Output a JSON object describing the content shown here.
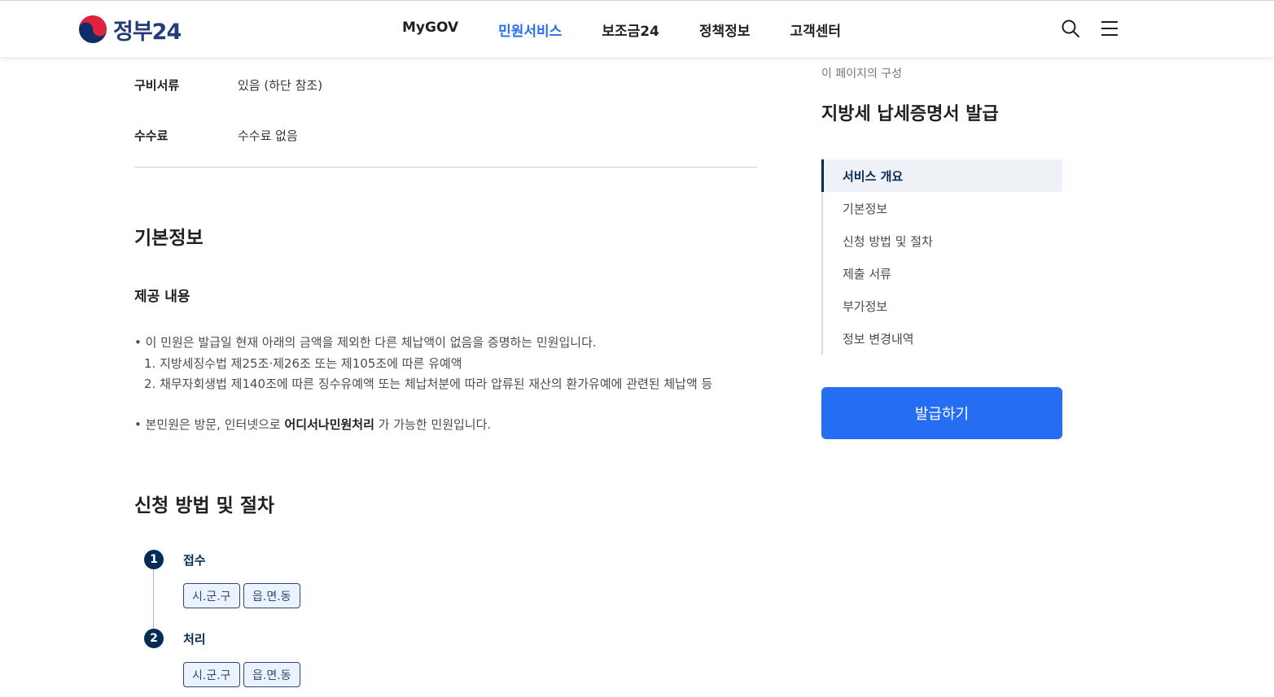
{
  "header": {
    "logo_text": "정부24",
    "nav": [
      "MyGOV",
      "민원서비스",
      "보조금24",
      "정책정보",
      "고객센터"
    ],
    "active_nav": "민원서비스"
  },
  "info_rows": [
    {
      "label": "구비서류",
      "value": "있음 (하단 참조)"
    },
    {
      "label": "수수료",
      "value": "수수료 없음"
    }
  ],
  "basic_info": {
    "heading": "기본정보",
    "sub_heading": "제공 내용",
    "bullet1": "• 이 민원은 발급일 현재 아래의 금액을 제외한 다른 체납액이 없음을 증명하는 민원입니다.",
    "item1": "1. 지방세징수법 제25조·제26조 또는 제105조에 따른 유예액",
    "item2": "2. 채무자회생법 제140조에 따른 징수유예액 또는 체납처분에 따라 압류된 재산의 환가유예에 관련된 체납액 등",
    "bullet2_pre": "• 본민원은 방문, 인터넷으로 ",
    "bullet2_bold": "어디서나민원처리",
    "bullet2_post": " 가 가능한 민원입니다."
  },
  "procedure": {
    "heading": "신청 방법 및 절차",
    "steps": [
      {
        "num": "1",
        "title": "접수",
        "chips": [
          "시.군.구",
          "읍.면.동"
        ]
      },
      {
        "num": "2",
        "title": "처리",
        "chips": [
          "시.군.구",
          "읍.면.동"
        ]
      }
    ]
  },
  "sidebar": {
    "caption": "이 페이지의 구성",
    "title": "지방세 납세증명서 발급",
    "toc": [
      "서비스 개요",
      "기본정보",
      "신청 방법 및 절차",
      "제출 서류",
      "부가정보",
      "정보 변경내역"
    ],
    "active_toc": "서비스 개요",
    "button": "발급하기"
  },
  "colors": {
    "primary": "#256ef4",
    "navy": "#052b57",
    "logo": "#243d7a"
  },
  "icons": [
    "search-icon",
    "menu-icon",
    "taegeuk-logo-icon"
  ]
}
